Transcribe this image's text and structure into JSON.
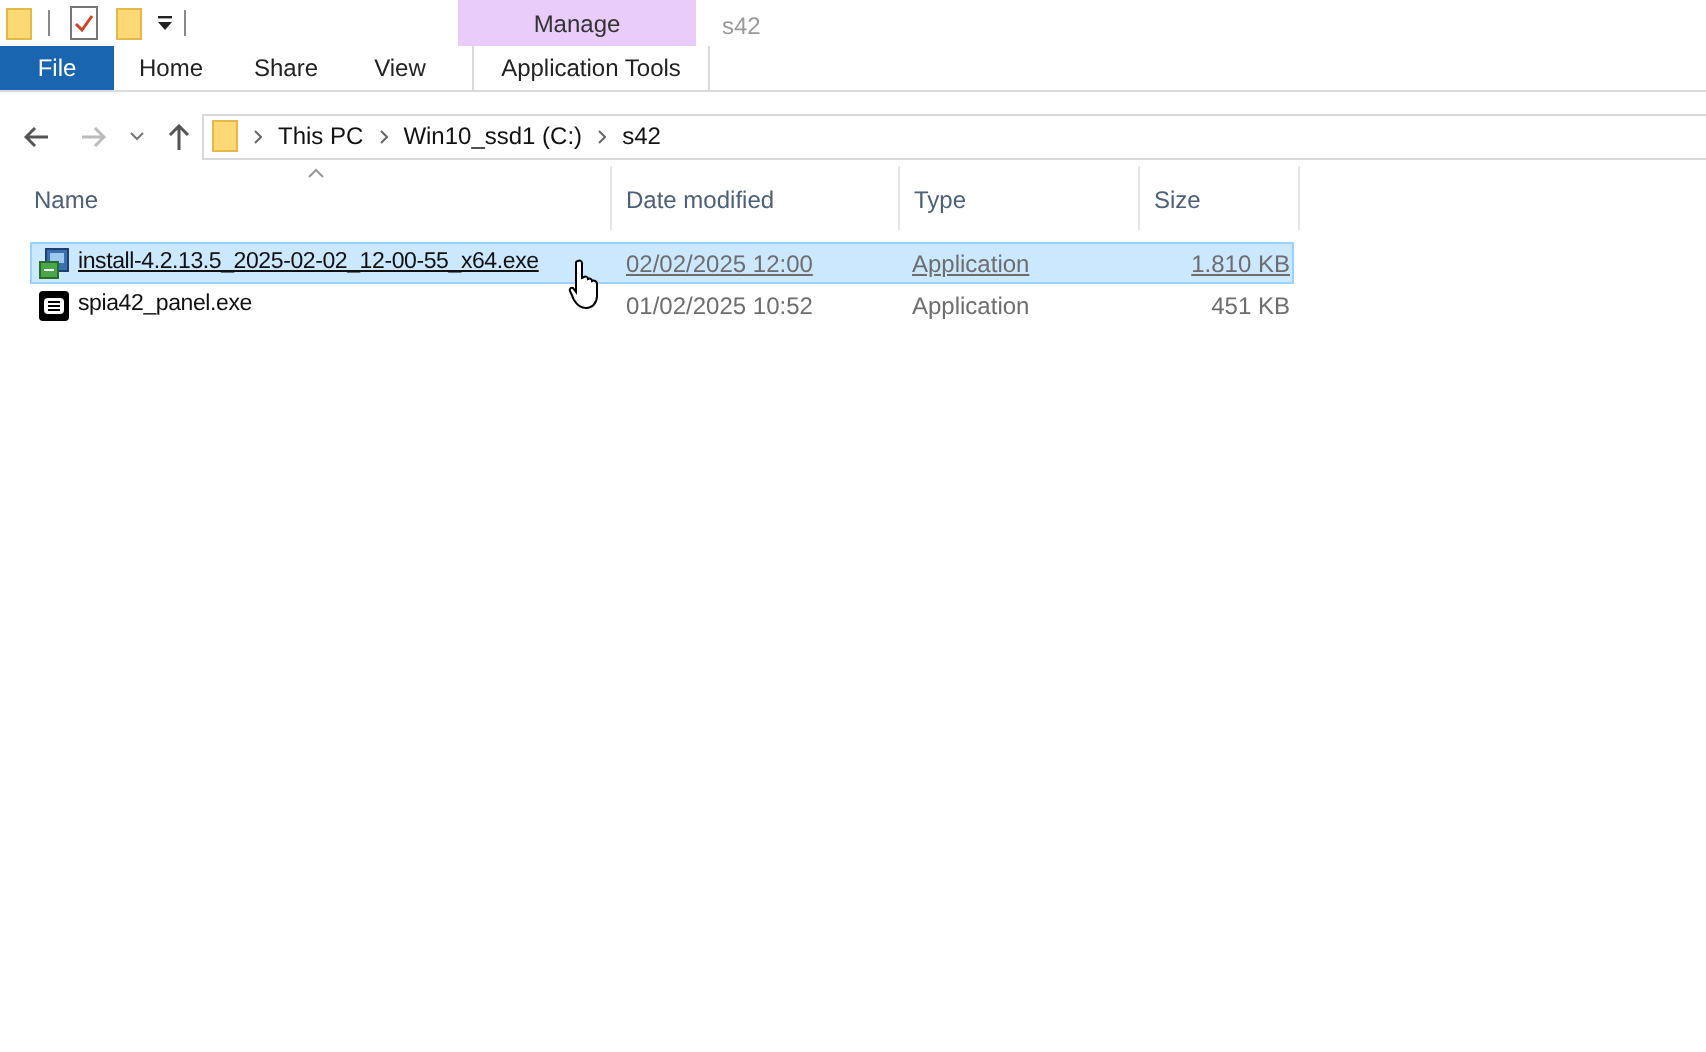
{
  "window": {
    "title": "s42"
  },
  "ribbon": {
    "context_group": "Manage",
    "tabs": [
      {
        "label": "File",
        "kind": "file",
        "selected": false
      },
      {
        "label": "Home",
        "kind": "tab",
        "selected": false
      },
      {
        "label": "Share",
        "kind": "tab",
        "selected": false
      },
      {
        "label": "View",
        "kind": "tab",
        "selected": false
      },
      {
        "label": "Application Tools",
        "kind": "context",
        "selected": false
      }
    ]
  },
  "address_bar": {
    "segments": [
      "This PC",
      "Win10_ssd1 (C:)",
      "s42"
    ]
  },
  "table": {
    "columns": [
      {
        "label": "Name",
        "sorted": true
      },
      {
        "label": "Date modified",
        "sorted": false
      },
      {
        "label": "Type",
        "sorted": false
      },
      {
        "label": "Size",
        "sorted": false
      }
    ],
    "rows": [
      {
        "name": "install-4.2.13.5_2025-02-02_12-00-55_x64.exe",
        "date": "02/02/2025 12:00",
        "type": "Application",
        "size": "1.810 KB",
        "selected": true,
        "hovered": true,
        "kind": "installer"
      },
      {
        "name": "spia42_panel.exe",
        "date": "01/02/2025 10:52",
        "type": "Application",
        "size": "451 KB",
        "selected": false,
        "hovered": false,
        "kind": "app"
      }
    ]
  }
}
